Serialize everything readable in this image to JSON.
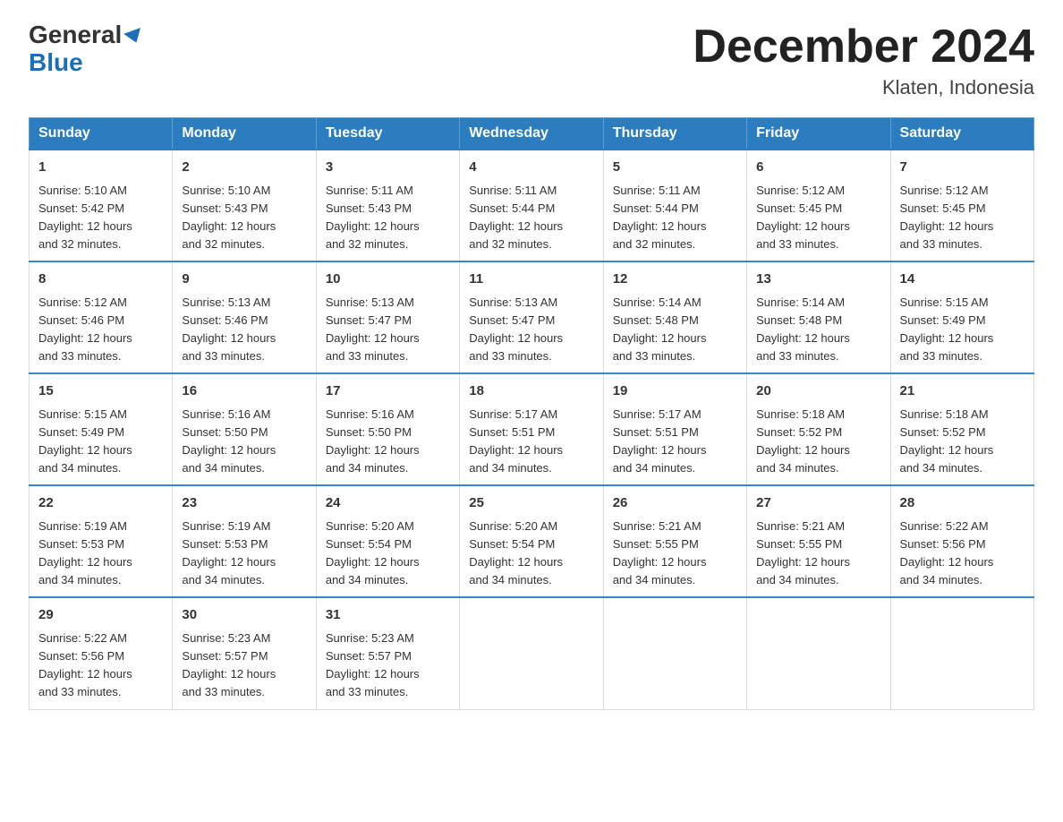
{
  "header": {
    "logo_general": "General",
    "logo_blue": "Blue",
    "month_title": "December 2024",
    "location": "Klaten, Indonesia"
  },
  "days_of_week": [
    "Sunday",
    "Monday",
    "Tuesday",
    "Wednesday",
    "Thursday",
    "Friday",
    "Saturday"
  ],
  "weeks": [
    [
      {
        "day": "1",
        "sunrise": "5:10 AM",
        "sunset": "5:42 PM",
        "daylight": "12 hours and 32 minutes."
      },
      {
        "day": "2",
        "sunrise": "5:10 AM",
        "sunset": "5:43 PM",
        "daylight": "12 hours and 32 minutes."
      },
      {
        "day": "3",
        "sunrise": "5:11 AM",
        "sunset": "5:43 PM",
        "daylight": "12 hours and 32 minutes."
      },
      {
        "day": "4",
        "sunrise": "5:11 AM",
        "sunset": "5:44 PM",
        "daylight": "12 hours and 32 minutes."
      },
      {
        "day": "5",
        "sunrise": "5:11 AM",
        "sunset": "5:44 PM",
        "daylight": "12 hours and 32 minutes."
      },
      {
        "day": "6",
        "sunrise": "5:12 AM",
        "sunset": "5:45 PM",
        "daylight": "12 hours and 33 minutes."
      },
      {
        "day": "7",
        "sunrise": "5:12 AM",
        "sunset": "5:45 PM",
        "daylight": "12 hours and 33 minutes."
      }
    ],
    [
      {
        "day": "8",
        "sunrise": "5:12 AM",
        "sunset": "5:46 PM",
        "daylight": "12 hours and 33 minutes."
      },
      {
        "day": "9",
        "sunrise": "5:13 AM",
        "sunset": "5:46 PM",
        "daylight": "12 hours and 33 minutes."
      },
      {
        "day": "10",
        "sunrise": "5:13 AM",
        "sunset": "5:47 PM",
        "daylight": "12 hours and 33 minutes."
      },
      {
        "day": "11",
        "sunrise": "5:13 AM",
        "sunset": "5:47 PM",
        "daylight": "12 hours and 33 minutes."
      },
      {
        "day": "12",
        "sunrise": "5:14 AM",
        "sunset": "5:48 PM",
        "daylight": "12 hours and 33 minutes."
      },
      {
        "day": "13",
        "sunrise": "5:14 AM",
        "sunset": "5:48 PM",
        "daylight": "12 hours and 33 minutes."
      },
      {
        "day": "14",
        "sunrise": "5:15 AM",
        "sunset": "5:49 PM",
        "daylight": "12 hours and 33 minutes."
      }
    ],
    [
      {
        "day": "15",
        "sunrise": "5:15 AM",
        "sunset": "5:49 PM",
        "daylight": "12 hours and 34 minutes."
      },
      {
        "day": "16",
        "sunrise": "5:16 AM",
        "sunset": "5:50 PM",
        "daylight": "12 hours and 34 minutes."
      },
      {
        "day": "17",
        "sunrise": "5:16 AM",
        "sunset": "5:50 PM",
        "daylight": "12 hours and 34 minutes."
      },
      {
        "day": "18",
        "sunrise": "5:17 AM",
        "sunset": "5:51 PM",
        "daylight": "12 hours and 34 minutes."
      },
      {
        "day": "19",
        "sunrise": "5:17 AM",
        "sunset": "5:51 PM",
        "daylight": "12 hours and 34 minutes."
      },
      {
        "day": "20",
        "sunrise": "5:18 AM",
        "sunset": "5:52 PM",
        "daylight": "12 hours and 34 minutes."
      },
      {
        "day": "21",
        "sunrise": "5:18 AM",
        "sunset": "5:52 PM",
        "daylight": "12 hours and 34 minutes."
      }
    ],
    [
      {
        "day": "22",
        "sunrise": "5:19 AM",
        "sunset": "5:53 PM",
        "daylight": "12 hours and 34 minutes."
      },
      {
        "day": "23",
        "sunrise": "5:19 AM",
        "sunset": "5:53 PM",
        "daylight": "12 hours and 34 minutes."
      },
      {
        "day": "24",
        "sunrise": "5:20 AM",
        "sunset": "5:54 PM",
        "daylight": "12 hours and 34 minutes."
      },
      {
        "day": "25",
        "sunrise": "5:20 AM",
        "sunset": "5:54 PM",
        "daylight": "12 hours and 34 minutes."
      },
      {
        "day": "26",
        "sunrise": "5:21 AM",
        "sunset": "5:55 PM",
        "daylight": "12 hours and 34 minutes."
      },
      {
        "day": "27",
        "sunrise": "5:21 AM",
        "sunset": "5:55 PM",
        "daylight": "12 hours and 34 minutes."
      },
      {
        "day": "28",
        "sunrise": "5:22 AM",
        "sunset": "5:56 PM",
        "daylight": "12 hours and 34 minutes."
      }
    ],
    [
      {
        "day": "29",
        "sunrise": "5:22 AM",
        "sunset": "5:56 PM",
        "daylight": "12 hours and 33 minutes."
      },
      {
        "day": "30",
        "sunrise": "5:23 AM",
        "sunset": "5:57 PM",
        "daylight": "12 hours and 33 minutes."
      },
      {
        "day": "31",
        "sunrise": "5:23 AM",
        "sunset": "5:57 PM",
        "daylight": "12 hours and 33 minutes."
      },
      null,
      null,
      null,
      null
    ]
  ],
  "labels": {
    "sunrise_prefix": "Sunrise: ",
    "sunset_prefix": "Sunset: ",
    "daylight_prefix": "Daylight: "
  }
}
